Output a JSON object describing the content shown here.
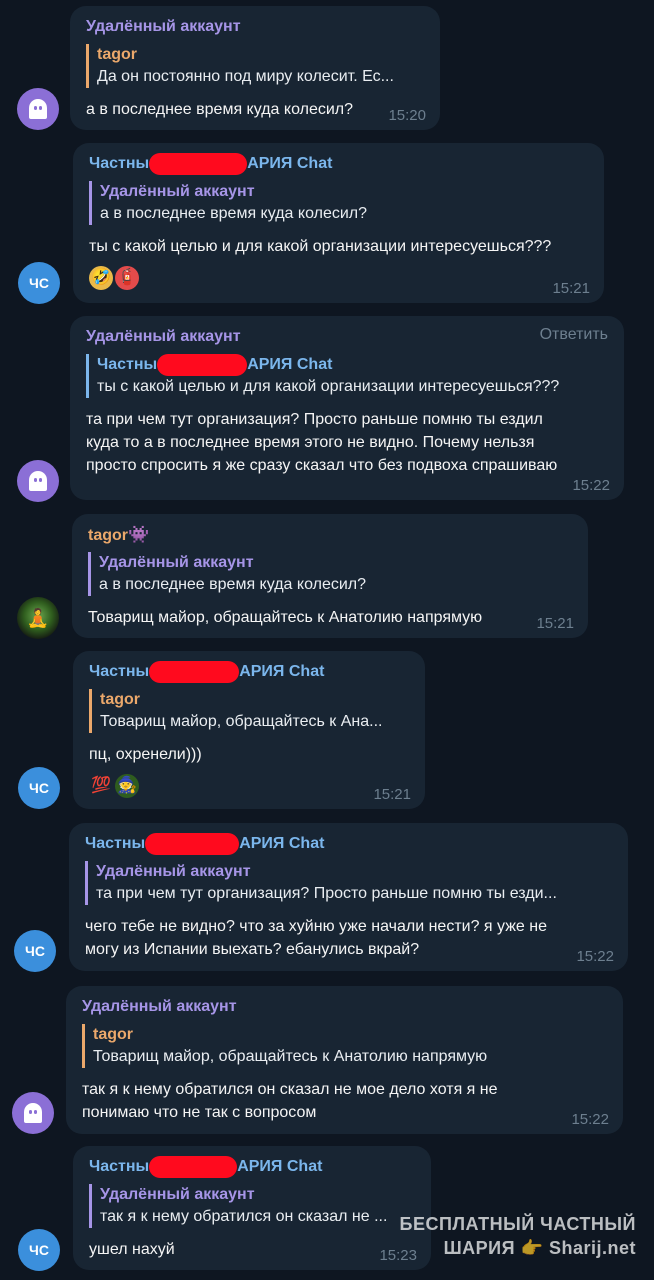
{
  "messages": [
    {
      "sender": "Удалённый аккаунт",
      "quote_name": "tagor",
      "quote_text": "Да он постоянно под миру колесит. Ес...",
      "text": "а в последнее время куда колесил?",
      "time": "15:20"
    },
    {
      "sender_a": "Частны",
      "sender_b": "АРИЯ Chat",
      "quote_name": "Удалённый аккаунт",
      "quote_text": "а в последнее время куда колесил?",
      "text": "ты с какой целью и для какой организации интересуешься???",
      "time": "15:21",
      "reactions": [
        "🤣",
        "🧯"
      ]
    },
    {
      "sender": "Удалённый аккаунт",
      "reply_label": "Ответить",
      "quote_name_a": "Частны",
      "quote_name_b": "АРИЯ Chat",
      "quote_text": "ты с какой целью и для какой организации интересуешься???",
      "text_lines": [
        "та при чем тут организация? Просто раньше помню ты ездил",
        "куда то а в последнее время этого не видно. Почему нельзя",
        "просто спросить я же сразу сказал что без подвоха спрашиваю"
      ],
      "time": "15:22"
    },
    {
      "sender": "tagor",
      "sender_emoji": "👾",
      "quote_name": "Удалённый аккаунт",
      "quote_text": "а в последнее время куда колесил?",
      "text": "Товарищ майор, обращайтесь к Анатолию напрямую",
      "time": "15:21"
    },
    {
      "sender_a": "Частны",
      "sender_b": "АРИЯ Chat",
      "quote_name": "tagor",
      "quote_text": "Товарищ майор, обращайтесь к Ана...",
      "text": "пц, охренели)))",
      "time": "15:21",
      "reactions": [
        "💯",
        "🧙"
      ]
    },
    {
      "sender_a": "Частны",
      "sender_b": "АРИЯ Chat",
      "quote_name": "Удалённый аккаунт",
      "quote_text": "та при чем тут организация? Просто раньше помню ты езди...",
      "text_lines": [
        "чего тебе не видно? что за хуйню уже начали нести? я уже не",
        "могу из Испании выехать? ебанулись вкрай?"
      ],
      "time": "15:22"
    },
    {
      "sender": "Удалённый аккаунт",
      "quote_name": "tagor",
      "quote_text": "Товарищ майор, обращайтесь к Анатолию напрямую",
      "text_lines": [
        "так я к нему обратился он сказал не мое дело хотя я не",
        "понимаю что не так с вопросом"
      ],
      "time": "15:22"
    },
    {
      "sender_a": "Частны",
      "sender_b": "АРИЯ Chat",
      "quote_name": "Удалённый аккаунт",
      "quote_text": "так я к нему обратился он сказал не ...",
      "text": "ушел нахуй",
      "time": "15:23"
    }
  ],
  "avatars": {
    "cs": "ЧС"
  },
  "watermark": {
    "line1": "БЕСПЛАТНЫЙ ЧАСТНЫЙ",
    "line2": "ШАРИЯ 👉 Sharij.net"
  },
  "colors": {
    "background": "#0e1621",
    "bubble": "#182533",
    "name_purple": "#a695e7",
    "name_blue": "#7bb6ec",
    "name_orange": "#eba86b",
    "redaction": "#ff0a1e"
  }
}
